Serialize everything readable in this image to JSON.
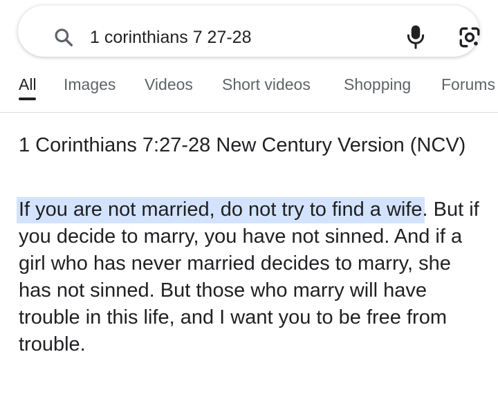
{
  "search": {
    "query": "1 corinthians 7 27-28",
    "icon_search": "search-icon",
    "icon_mic": "microphone-icon",
    "icon_lens": "lens-icon"
  },
  "tabs": [
    {
      "label": "All",
      "active": true
    },
    {
      "label": "Images",
      "active": false
    },
    {
      "label": "Videos",
      "active": false
    },
    {
      "label": "Short videos",
      "active": false
    },
    {
      "label": "Shopping",
      "active": false
    },
    {
      "label": "Forums",
      "active": false
    }
  ],
  "result": {
    "reference": "1 Corinthians 7:27-28 New Century Version (NCV)",
    "highlighted_text": "If you are not married, do not try to find a wife",
    "body_text": ". But if you decide to marry, you have not sinned. And if a girl who has never married decides to marry, she has not sinned. But those who marry will have trouble in this life, and I want you to be free from trouble."
  },
  "colors": {
    "highlight": "#d3e3fd",
    "text": "#202124",
    "muted": "#5f6368",
    "divider": "#dadce0"
  }
}
